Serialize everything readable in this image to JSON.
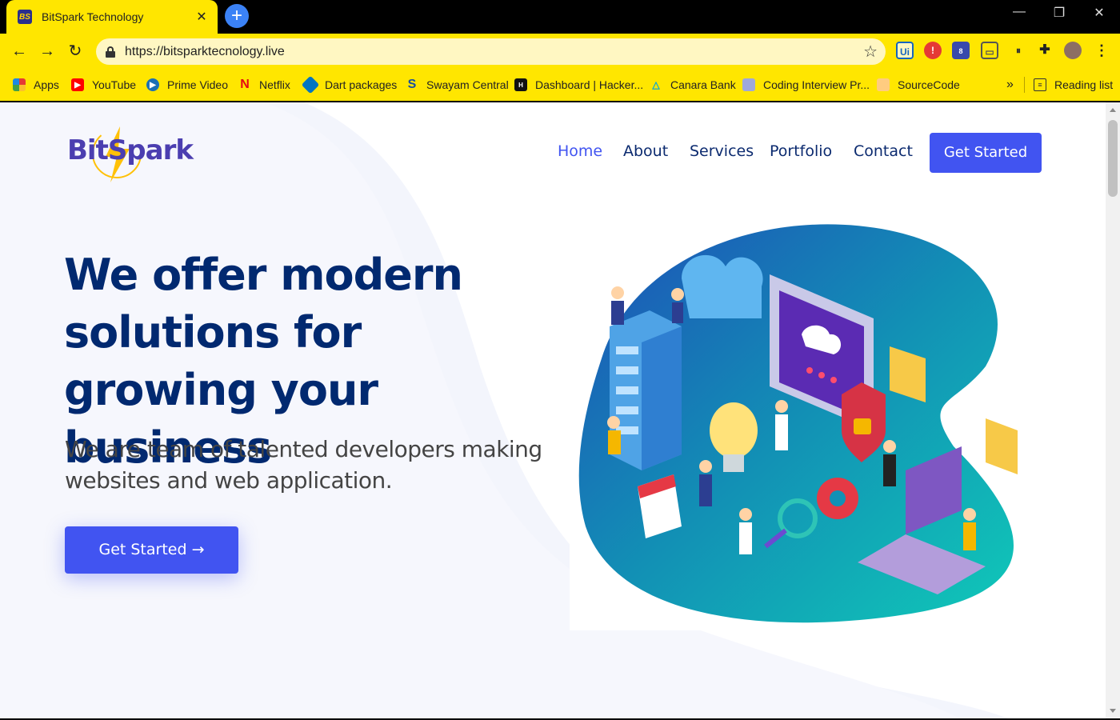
{
  "browser": {
    "tab_title": "BitSpark Technology",
    "tab_favicon": "BS",
    "tab_close": "✕",
    "new_tab": "+",
    "url": "https://bitsparktecnology.live",
    "window_controls": [
      "—",
      "❐",
      "✕"
    ],
    "bookmarks": [
      {
        "label": "Apps",
        "icon": "apps-grid-icon",
        "color": "#e53935"
      },
      {
        "label": "YouTube",
        "icon": "youtube-icon",
        "color": "#ff0000"
      },
      {
        "label": "Prime Video",
        "icon": "prime-video-icon",
        "color": "#1a6fb5"
      },
      {
        "label": "Netflix",
        "icon": "netflix-icon",
        "color": "#e50914"
      },
      {
        "label": "Dart packages",
        "icon": "dart-icon",
        "color": "#0175C2"
      },
      {
        "label": "Swayam Central",
        "icon": "swayam-icon",
        "color": "#1a4fa0"
      },
      {
        "label": "Dashboard | Hacker...",
        "icon": "hackerrank-icon",
        "color": "#111"
      },
      {
        "label": "Canara Bank",
        "icon": "canara-icon",
        "color": "#00a3e0"
      },
      {
        "label": "Coding Interview Pr...",
        "icon": "coding-interview-icon",
        "color": "#5c6bc0"
      },
      {
        "label": "SourceCode",
        "icon": "sourcecode-icon",
        "color": "#ff9800"
      }
    ],
    "bookmarks_overflow": "»",
    "reading_list": "Reading list",
    "extension_badge": "8"
  },
  "site": {
    "logo": "BitSpark",
    "nav": [
      "Home",
      "About",
      "Services",
      "Portfolio",
      "Contact"
    ],
    "nav_cta": "Get Started",
    "hero_title": "We offer modern solutions for growing your business",
    "hero_subtitle": "We are team of talented developers making websites and web application.",
    "hero_cta": "Get Started",
    "hero_cta_arrow": "→"
  },
  "colors": {
    "chrome": "#FFE600",
    "brand": "#4154f1",
    "heading": "#012970"
  }
}
